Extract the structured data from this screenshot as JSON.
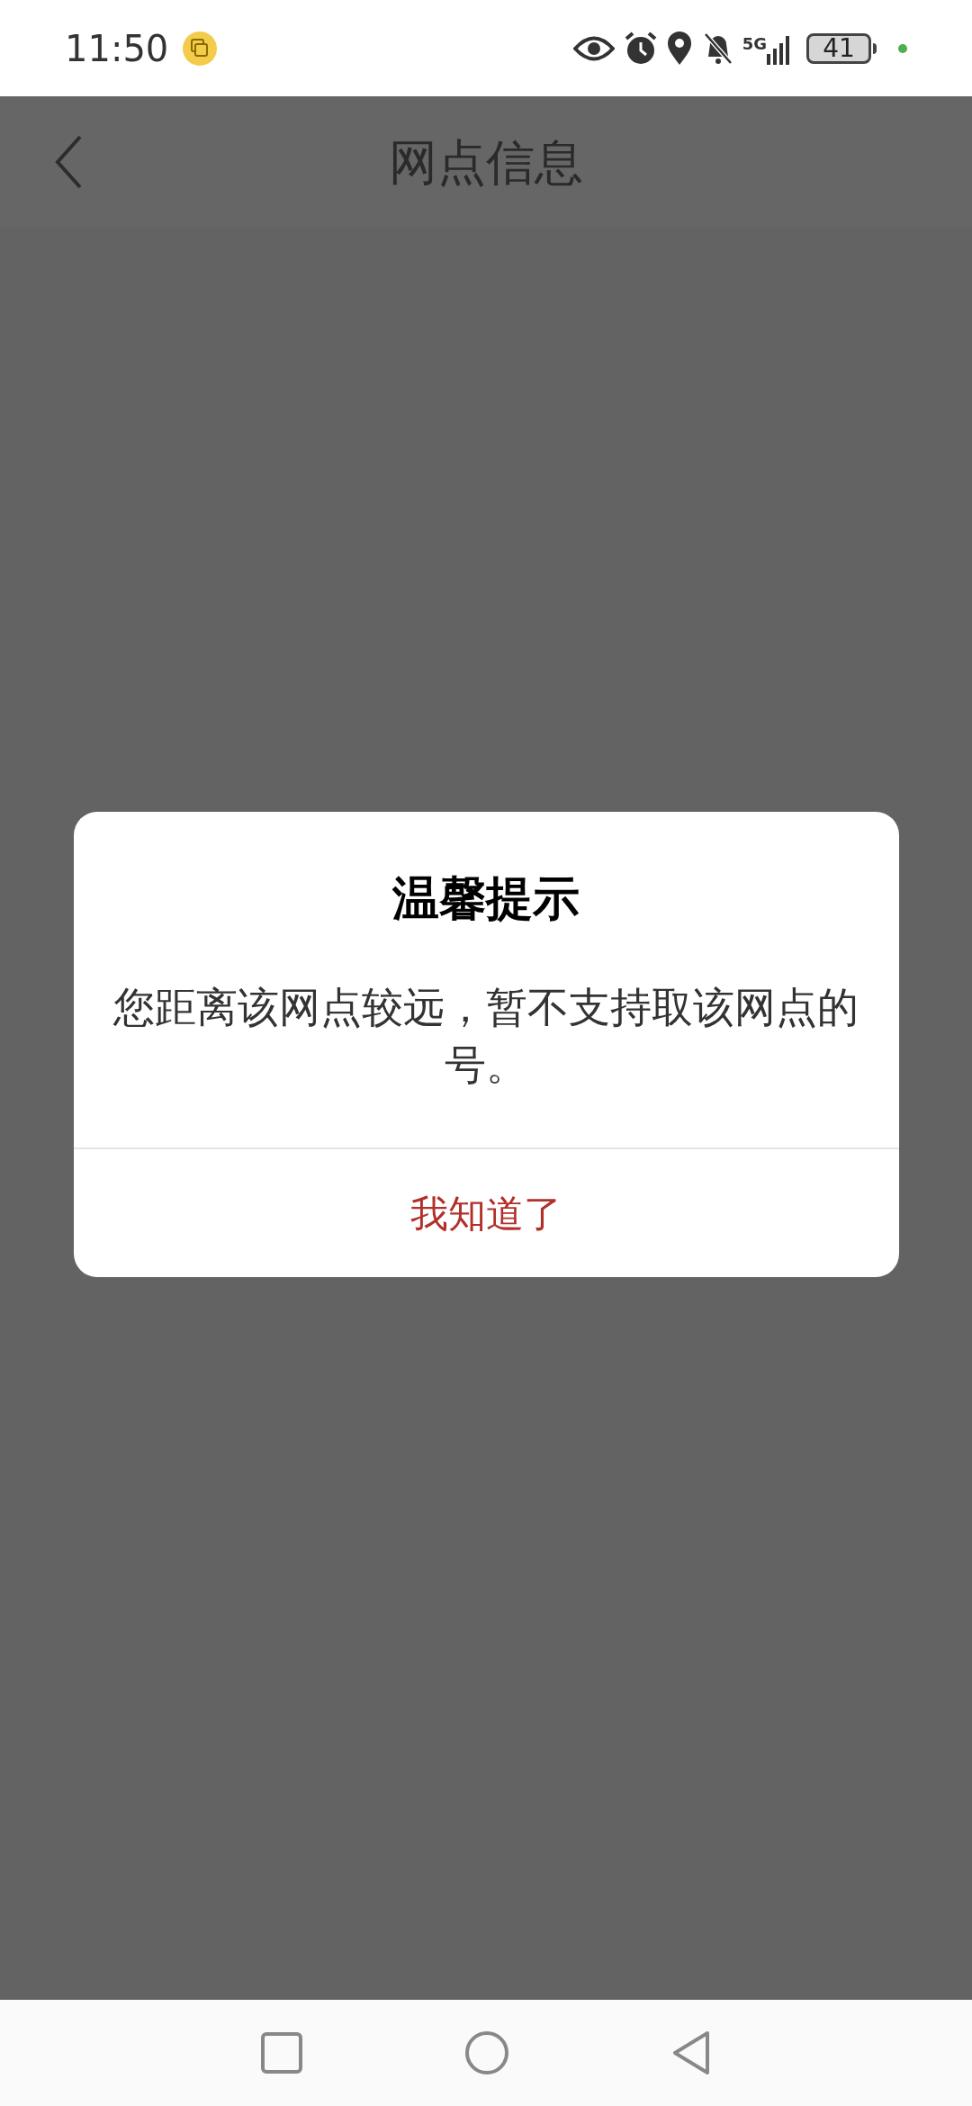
{
  "status_bar": {
    "time": "11:50",
    "network": "5G",
    "battery": "41"
  },
  "header": {
    "title": "网点信息"
  },
  "dialog": {
    "title": "温馨提示",
    "message": "您距离该网点较远，暂不支持取该网点的号。",
    "button": "我知道了"
  }
}
